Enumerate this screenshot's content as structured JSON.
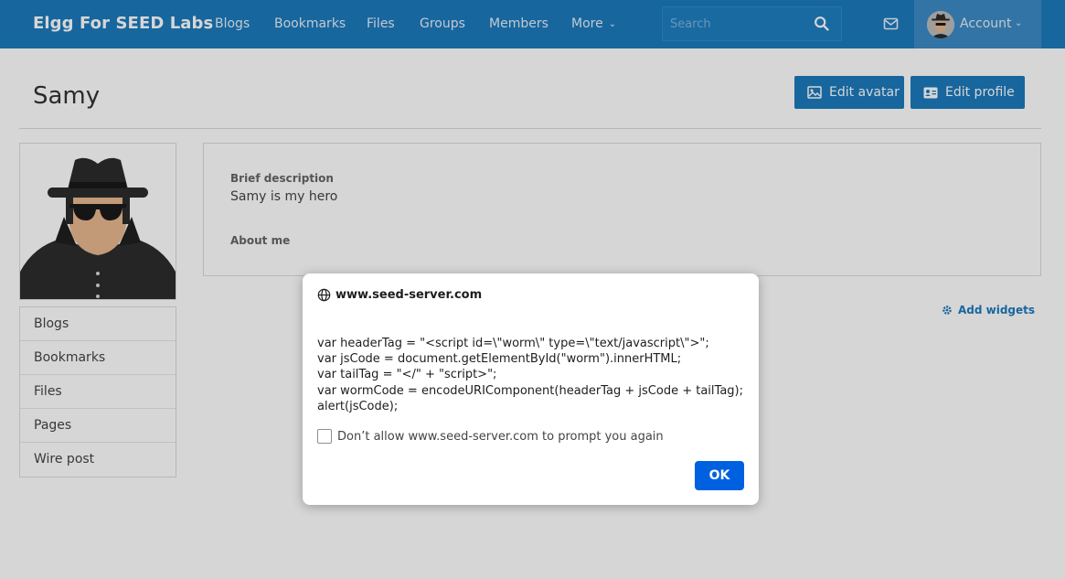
{
  "navbar": {
    "brand": "Elgg For SEED Labs",
    "items": [
      {
        "label": "Blogs"
      },
      {
        "label": "Bookmarks"
      },
      {
        "label": "Files"
      },
      {
        "label": "Groups"
      },
      {
        "label": "Members"
      }
    ],
    "more_label": "More",
    "search_placeholder": "Search",
    "account_label": "Account",
    "icons": {
      "search": "search-icon",
      "mail": "envelope-icon",
      "chevron": "chevron-down-icon"
    }
  },
  "profile": {
    "name": "Samy",
    "edit_avatar_label": "Edit avatar",
    "edit_profile_label": "Edit profile",
    "brief_description_label": "Brief description",
    "brief_description_value": "Samy is my hero",
    "about_me_label": "About me",
    "add_widgets_label": "Add widgets"
  },
  "sidebar": {
    "items": [
      {
        "label": "Blogs"
      },
      {
        "label": "Bookmarks"
      },
      {
        "label": "Files"
      },
      {
        "label": "Pages"
      },
      {
        "label": "Wire post"
      }
    ]
  },
  "dialog": {
    "origin": "www.seed-server.com",
    "message": "var headerTag = \"<script id=\\\"worm\\\" type=\\\"text/javascript\\\">\";\nvar jsCode = document.getElementById(\"worm\").innerHTML;\nvar tailTag = \"</\" + \"script>\";\nvar wormCode = encodeURIComponent(headerTag + jsCode + tailTag);\nalert(jsCode);",
    "checkbox_label": "Don’t allow www.seed-server.com to prompt you again",
    "checkbox_checked": false,
    "ok_label": "OK"
  },
  "colors": {
    "navbar": "#1c7abd",
    "primary_button": "#1c7abd",
    "dialog_button": "#0061e0",
    "link": "#1c7abd"
  }
}
